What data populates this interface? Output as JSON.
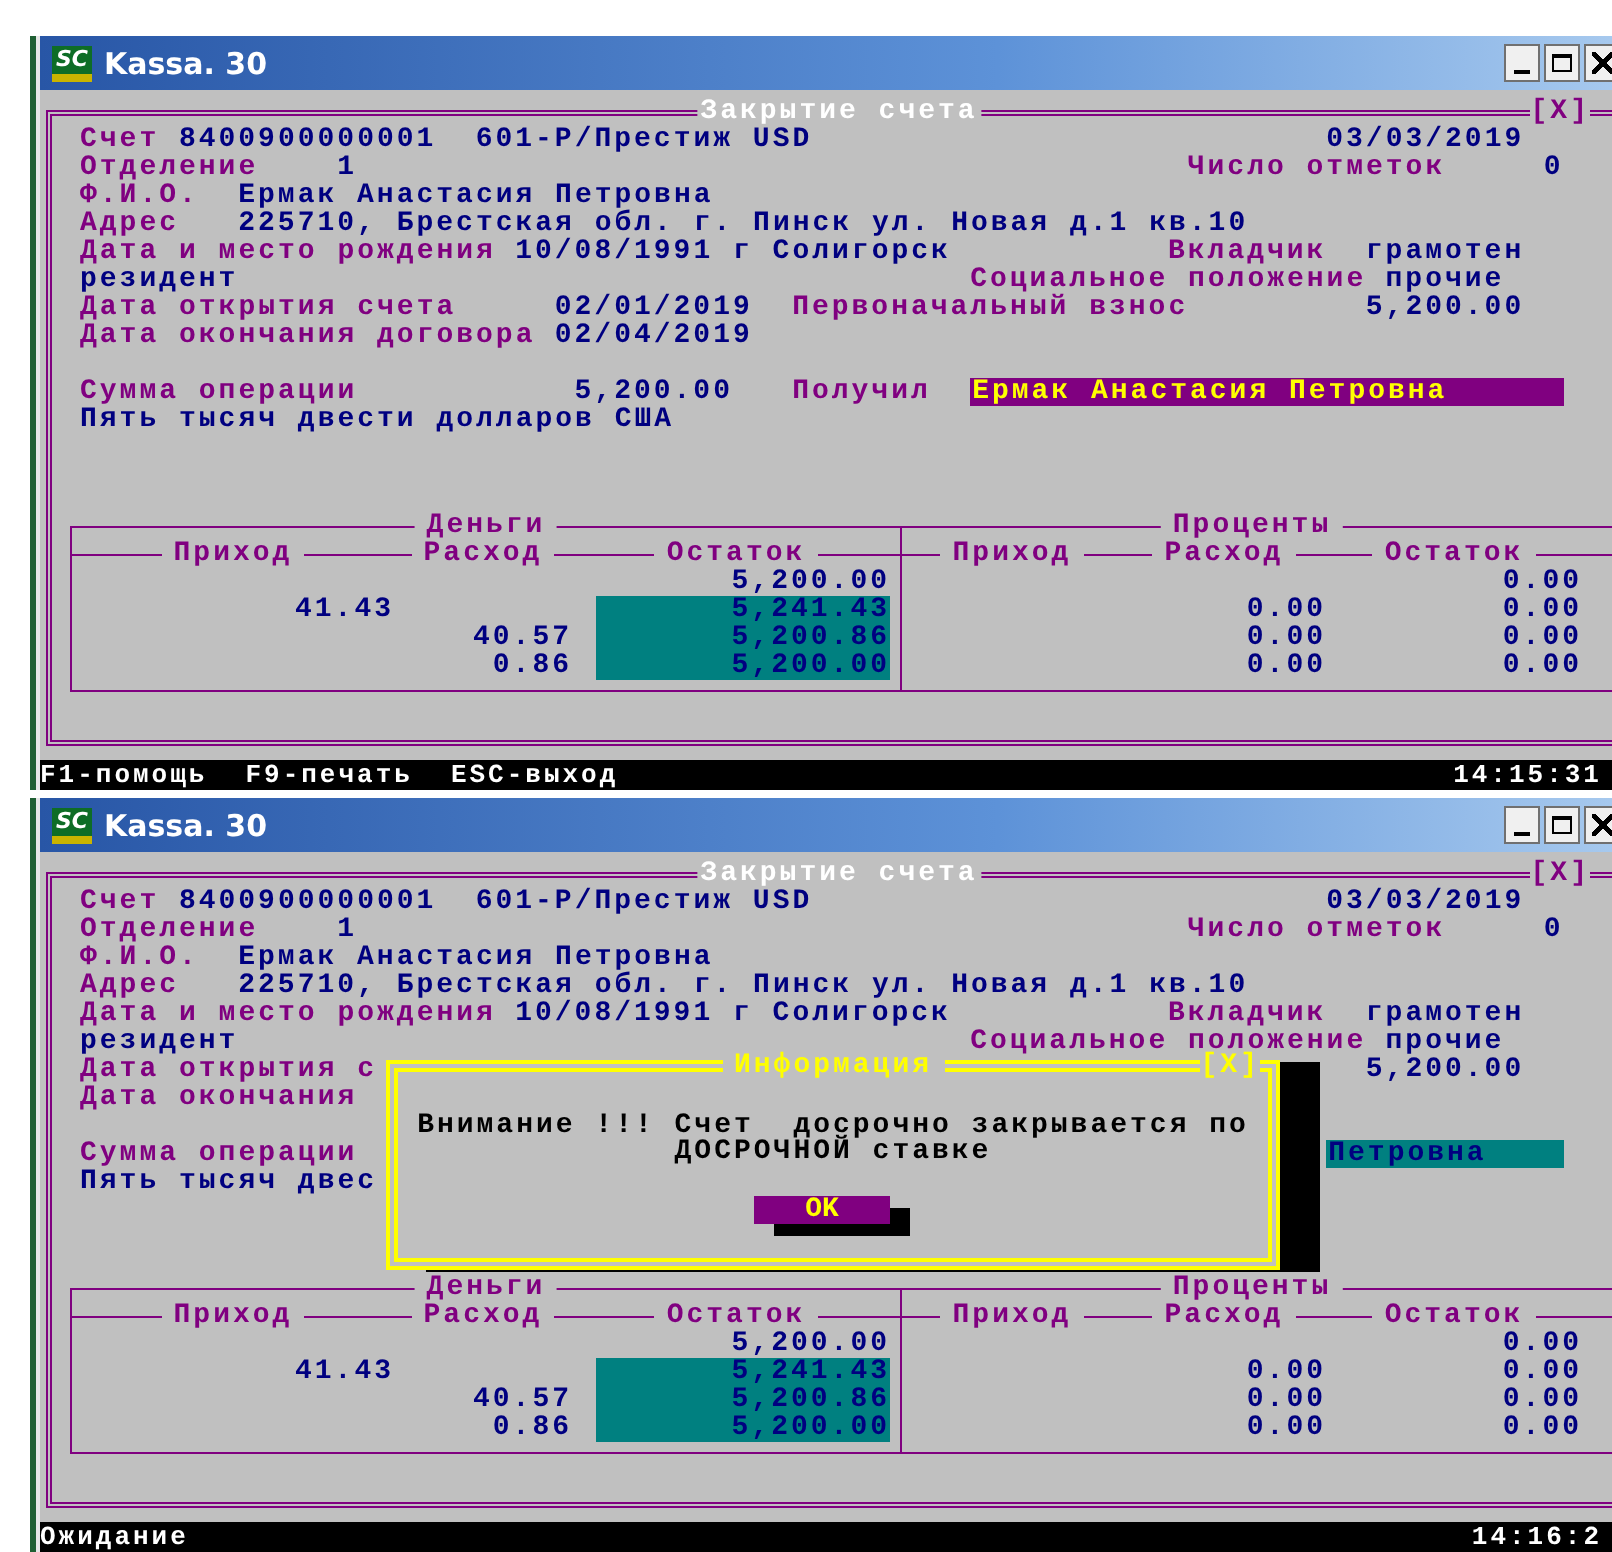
{
  "windows": [
    {
      "logo_text": "SC",
      "title": "Kassa. 30",
      "form": {
        "title": "Закрытие счета",
        "close": "[X]",
        "account_label": "Счет",
        "account_number": "8400900000001",
        "account_product": "601-Р/Престиж USD",
        "date": "03/03/2019",
        "branch_label": "Отделение",
        "branch_value": "1",
        "marks_label": "Число отметок",
        "marks_value": "0",
        "name_label": "Ф.И.О.",
        "name_value": "Ермак Анастасия Петровна",
        "address_label": "Адрес",
        "address_value": "225710, Брестская обл. г. Пинск ул. Новая д.1 кв.10",
        "birth_label": "Дата и место рождения",
        "birth_value": "10/08/1991 г Солигорск",
        "depositor_label": "Вкладчик",
        "depositor_value": "грамотен",
        "resident": "резидент",
        "social_label": "Социальное положение",
        "social_value": "прочие",
        "opened_label": "Дата открытия счета",
        "opened_value": "02/01/2019",
        "initial_label": "Первоначальный взнос",
        "initial_value": "5,200.00",
        "end_label": "Дата окончания договора",
        "end_value": "02/04/2019",
        "amount_label": "Сумма операции",
        "amount_value": "5,200.00",
        "received_label": "Получил",
        "received": {
          "value": "Ермак Анастасия Петровна",
          "focused": true
        },
        "amount_words": "Пять тысяч двести долларов США"
      },
      "table": {
        "groups": [
          {
            "title": "Деньги",
            "columns": [
              "Приход",
              "Расход",
              "Остаток"
            ]
          },
          {
            "title": "Проценты",
            "columns": [
              "Приход",
              "Расход",
              "Остаток"
            ]
          }
        ],
        "rows": [
          {
            "highlighted": false,
            "cells": [
              null,
              null,
              "5,200.00",
              null,
              null,
              "0.00"
            ]
          },
          {
            "highlighted": true,
            "cells": [
              "41.43",
              null,
              "5,241.43",
              null,
              "0.00",
              "0.00"
            ]
          },
          {
            "highlighted": true,
            "cells": [
              null,
              "40.57",
              "5,200.86",
              null,
              "0.00",
              "0.00"
            ]
          },
          {
            "highlighted": true,
            "cells": [
              null,
              "0.86",
              "5,200.00",
              null,
              "0.00",
              "0.00"
            ]
          }
        ]
      },
      "status": {
        "items": [
          "F1-помощь",
          "F9-печать",
          "ESC-выход"
        ],
        "time": "14:15:31"
      }
    },
    {
      "logo_text": "SC",
      "title": "Kassa. 30",
      "form": {
        "title": "Закрытие счета",
        "close": "[X]",
        "account_label": "Счет",
        "account_number": "8400900000001",
        "account_product": "601-Р/Престиж USD",
        "date": "03/03/2019",
        "branch_label": "Отделение",
        "branch_value": "1",
        "marks_label": "Число отметок",
        "marks_value": "0",
        "name_label": "Ф.И.О.",
        "name_value": "Ермак Анастасия Петровна",
        "address_label": "Адрес",
        "address_value": "225710, Брестская обл. г. Пинск ул. Новая д.1 кв.10",
        "birth_label": "Дата и место рождения",
        "birth_value": "10/08/1991 г Солигорск",
        "depositor_label": "Вкладчик",
        "depositor_value": "грамотен",
        "resident": "резидент",
        "social_label": "Социальное положение",
        "social_value": "прочие",
        "opened_label": "Дата открытия с",
        "initial_value": "5,200.00",
        "end_label": "Дата окончания",
        "amount_label": "Сумма операции",
        "received": {
          "value": "Петровна",
          "focused": false
        },
        "amount_words": "Пять тысяч двес"
      },
      "table": {
        "groups": [
          {
            "title": "Деньги",
            "columns": [
              "Приход",
              "Расход",
              "Остаток"
            ]
          },
          {
            "title": "Проценты",
            "columns": [
              "Приход",
              "Расход",
              "Остаток"
            ]
          }
        ],
        "rows": [
          {
            "highlighted": false,
            "cells": [
              null,
              null,
              "5,200.00",
              null,
              null,
              "0.00"
            ]
          },
          {
            "highlighted": true,
            "cells": [
              "41.43",
              null,
              "5,241.43",
              null,
              "0.00",
              "0.00"
            ]
          },
          {
            "highlighted": true,
            "cells": [
              null,
              "40.57",
              "5,200.86",
              null,
              "0.00",
              "0.00"
            ]
          },
          {
            "highlighted": true,
            "cells": [
              null,
              "0.86",
              "5,200.00",
              null,
              "0.00",
              "0.00"
            ]
          }
        ]
      },
      "dialog": {
        "title": "Информация",
        "close": "[X]",
        "message_lines": [
          "Внимание !!! Счет  досрочно закрывается по",
          "ДОСРОЧНОЙ ставке"
        ],
        "button": "OK"
      },
      "status": {
        "items": [
          "Ожидание"
        ],
        "time": "14:16:2"
      }
    }
  ]
}
